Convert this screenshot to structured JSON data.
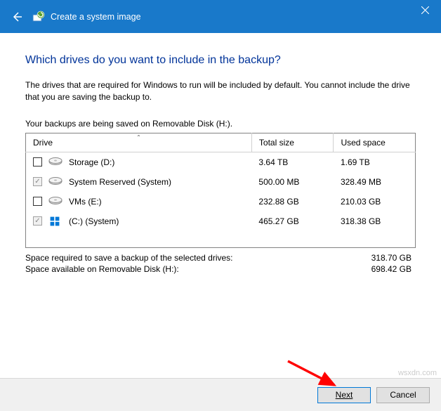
{
  "titlebar": {
    "title": "Create a system image"
  },
  "heading": "Which drives do you want to include in the backup?",
  "description": "The drives that are required for Windows to run will be included by default. You cannot include the drive that you are saving the backup to.",
  "saving_line": "Your backups are being saved on Removable Disk (H:).",
  "columns": {
    "drive": "Drive",
    "total": "Total size",
    "used": "Used space"
  },
  "drives": [
    {
      "label": "Storage (D:)",
      "total": "3.64 TB",
      "used": "1.69 TB",
      "checked": false,
      "enabled": true,
      "icon": "hdd"
    },
    {
      "label": "System Reserved (System)",
      "total": "500.00 MB",
      "used": "328.49 MB",
      "checked": true,
      "enabled": false,
      "icon": "hdd"
    },
    {
      "label": "VMs (E:)",
      "total": "232.88 GB",
      "used": "210.03 GB",
      "checked": false,
      "enabled": true,
      "icon": "hdd"
    },
    {
      "label": "(C:) (System)",
      "total": "465.27 GB",
      "used": "318.38 GB",
      "checked": true,
      "enabled": false,
      "icon": "win"
    }
  ],
  "summary": {
    "required_label": "Space required to save a backup of the selected drives:",
    "required_value": "318.70 GB",
    "available_label": "Space available on Removable Disk (H:):",
    "available_value": "698.42 GB"
  },
  "buttons": {
    "next": "Next",
    "cancel": "Cancel"
  },
  "watermark": "wsxdn.com"
}
